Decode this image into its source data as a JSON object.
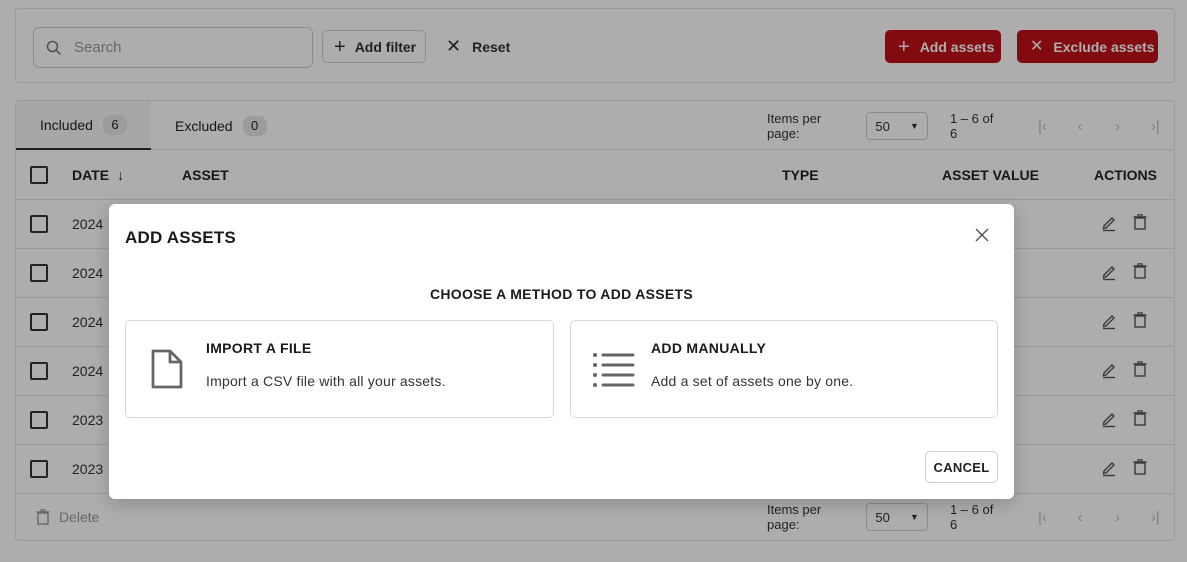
{
  "toolbar": {
    "search_placeholder": "Search",
    "add_filter_label": "Add filter",
    "reset_label": "Reset",
    "add_assets_label": "Add assets",
    "exclude_assets_label": "Exclude assets",
    "accent_color": "#c0101a"
  },
  "tabs": [
    {
      "label": "Included",
      "count": "6",
      "active": true
    },
    {
      "label": "Excluded",
      "count": "0",
      "active": false
    }
  ],
  "pagination": {
    "items_per_page_label": "Items per page:",
    "items_per_page_value": "50",
    "range_text": "1 – 6 of 6"
  },
  "table": {
    "columns": [
      "DATE",
      "ASSET",
      "TYPE",
      "ASSET VALUE",
      "ACTIONS"
    ],
    "rows": [
      {
        "date": "2024"
      },
      {
        "date": "2024"
      },
      {
        "date": "2024"
      },
      {
        "date": "2024"
      },
      {
        "date": "2023"
      },
      {
        "date": "2023"
      }
    ]
  },
  "footer": {
    "delete_label": "Delete"
  },
  "modal": {
    "title": "ADD ASSETS",
    "subtitle": "CHOOSE A METHOD TO ADD ASSETS",
    "options": [
      {
        "title": "IMPORT A FILE",
        "description": "Import a CSV file with all your assets.",
        "icon": "file-icon"
      },
      {
        "title": "ADD MANUALLY",
        "description": "Add a set of assets one by one.",
        "icon": "list-icon"
      }
    ],
    "cancel_label": "CANCEL"
  }
}
